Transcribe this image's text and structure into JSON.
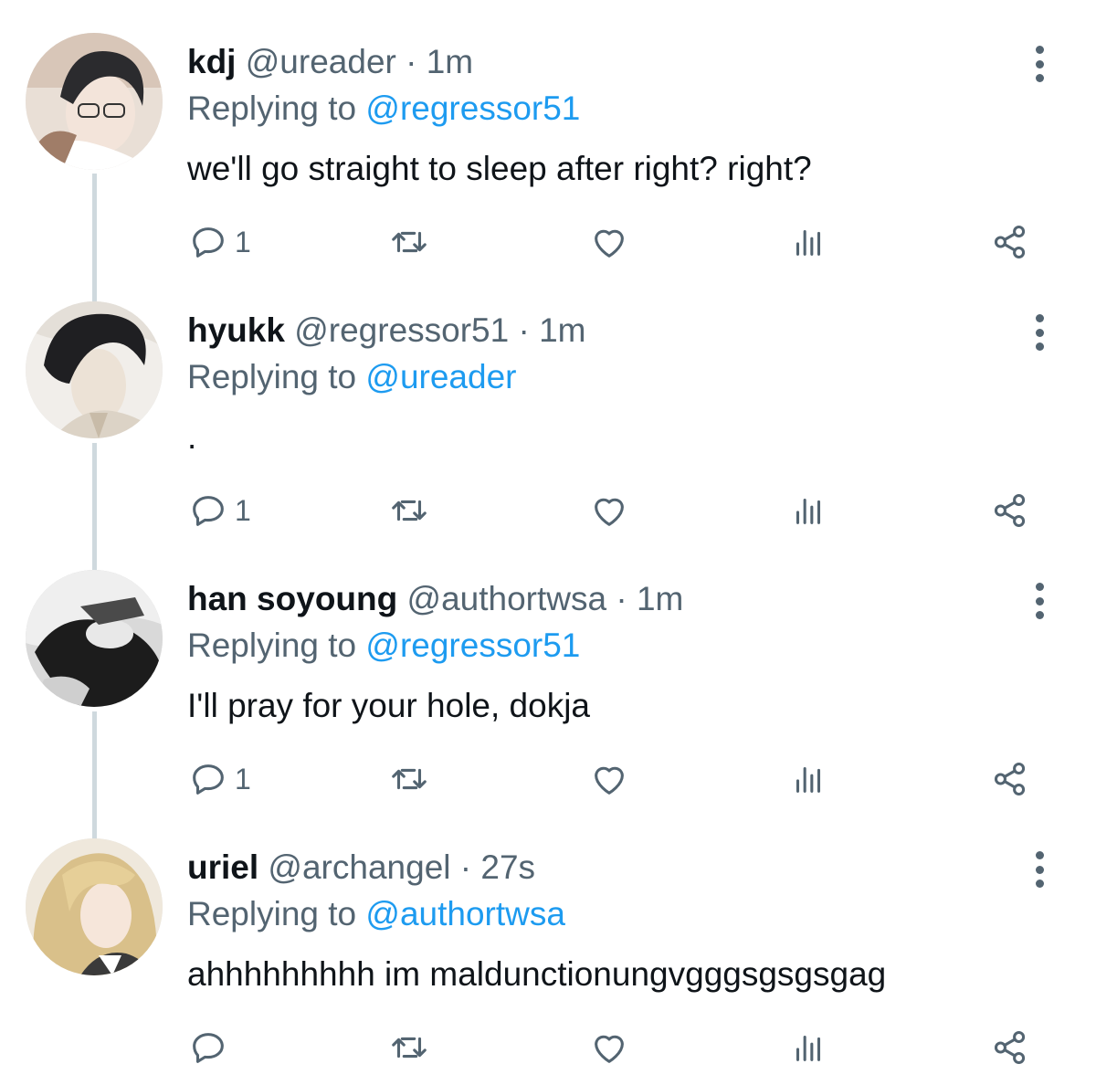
{
  "tweets": [
    {
      "name": "kdj",
      "handle": "@ureader",
      "dot": "·",
      "time": "1m",
      "reply_prefix": "Replying to ",
      "reply_to": "@regressor51",
      "text": "we'll go straight to sleep after right? right?",
      "reply_count": "1"
    },
    {
      "name": "hyukk",
      "handle": "@regressor51",
      "dot": "·",
      "time": "1m",
      "reply_prefix": "Replying to ",
      "reply_to": "@ureader",
      "text": ".",
      "reply_count": "1"
    },
    {
      "name": "han soyoung",
      "handle": "@authortwsa",
      "dot": "·",
      "time": "1m",
      "reply_prefix": "Replying to ",
      "reply_to": "@regressor51",
      "text": "I'll pray for your hole, dokja",
      "reply_count": "1"
    },
    {
      "name": "uriel",
      "handle": "@archangel",
      "dot": "·",
      "time": "27s",
      "reply_prefix": "Replying to ",
      "reply_to": "@authortwsa",
      "text": "ahhhhhhhhh im maldunctionungvgggsgsgsgag",
      "reply_count": ""
    }
  ],
  "icons": {
    "reply": "reply-icon",
    "retweet": "retweet-icon",
    "like": "like-icon",
    "views": "views-icon",
    "share": "share-icon",
    "more": "more-icon"
  },
  "colors": {
    "text": "#0f1419",
    "secondary": "#536471",
    "link": "#1d9bf0",
    "thread_line": "#cfd9de"
  }
}
